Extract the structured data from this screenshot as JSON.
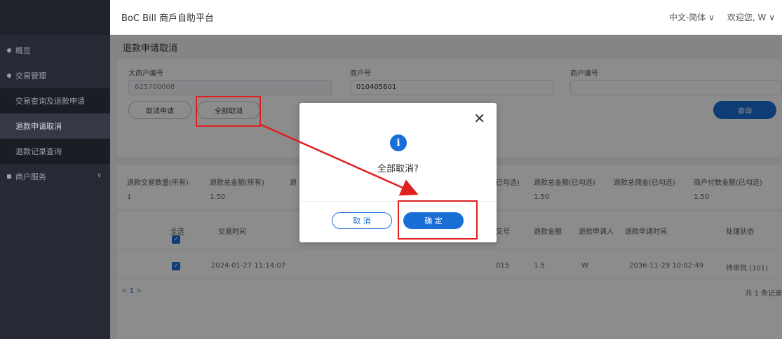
{
  "header": {
    "app_title": "BoC Bill 商戶自助平台",
    "language": "中文-简体 ∨",
    "welcome": "欢迎您, W ∨"
  },
  "sidebar": {
    "items": [
      {
        "label": "概览"
      },
      {
        "label": "交易管理"
      },
      {
        "label": "交易查询及退款申请"
      },
      {
        "label": "退款申请取消"
      },
      {
        "label": "退款记录查询"
      },
      {
        "label": "商户服务"
      }
    ]
  },
  "page": {
    "title": "退款申请取消"
  },
  "filters": {
    "big_merchant_label": "大商户编号",
    "big_merchant_value": "625700008",
    "merchant_label": "商户号",
    "merchant_value": "010405601",
    "merchant_no_label": "商户编号",
    "merchant_no_value": ""
  },
  "buttons": {
    "cancel_apply": "取消申请",
    "cancel_all": "全部取消",
    "query": "查询"
  },
  "summary": {
    "headers": [
      "退款交易数量(所有)",
      "退款总金额(所有)",
      "退",
      "(已勾选)",
      "退款总金额(已勾选)",
      "退款总佣金(已勾选)",
      "商户付数金额(已勾选)"
    ],
    "values": [
      "1",
      "1.50",
      "",
      "",
      "1.50",
      "",
      "1.50"
    ]
  },
  "table": {
    "headers": [
      "全选",
      "交易时间",
      "又号",
      "退款金额",
      "退款申请人",
      "退款申请时间",
      "处理状态"
    ],
    "row": {
      "time": "2024-01-27 11:14:07",
      "no": "015",
      "amount": "1.5",
      "applicant": "W",
      "apply_time": "2036-11-29 10:02:49",
      "status": "待审批 (101)"
    }
  },
  "pager": {
    "prev": "<",
    "page": "1",
    "next": ">",
    "total": "共 1 条记录"
  },
  "dialog": {
    "close": "✕",
    "icon": "i",
    "message": "全部取消?",
    "cancel": "取 消",
    "ok": "确 定"
  },
  "colors": {
    "primary": "#1a6fd6",
    "annotation": "#e02020",
    "sidebar": "#272a35"
  }
}
